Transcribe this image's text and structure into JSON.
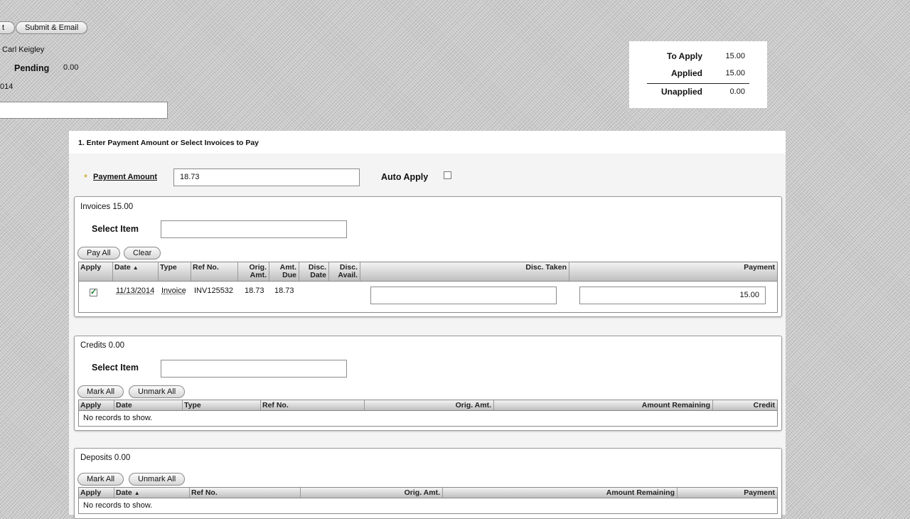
{
  "toolbar": {
    "partial_button_label": "t",
    "submit_email_label": "Submit & Email"
  },
  "header": {
    "customer_name": "Carl Keigley",
    "pending_label": "Pending",
    "pending_value": "0.00",
    "date_fragment": "014",
    "memo_value": ""
  },
  "summary": {
    "to_apply_label": "To Apply",
    "to_apply_value": "15.00",
    "applied_label": "Applied",
    "applied_value": "15.00",
    "unapplied_label": "Unapplied",
    "unapplied_value": "0.00"
  },
  "step": {
    "title": "1. Enter Payment Amount or Select Invoices to Pay",
    "required_mark": "*",
    "payment_amount_label": "Payment Amount",
    "payment_amount_value": "18.73",
    "auto_apply_label": "Auto Apply",
    "auto_apply_checked": false
  },
  "invoices": {
    "title": "Invoices 15.00",
    "select_item_label": "Select Item",
    "select_item_value": "",
    "pay_all_label": "Pay All",
    "clear_label": "Clear",
    "columns": [
      "Apply",
      "Date",
      "Type",
      "Ref No.",
      "Orig. Amt.",
      "Amt. Due",
      "Disc. Date",
      "Disc. Avail.",
      "Disc. Taken",
      "Payment"
    ],
    "rows": [
      {
        "apply": true,
        "date": "11/13/2014",
        "type": "Invoice",
        "ref_no": "INV125532",
        "orig_amt": "18.73",
        "amt_due": "18.73",
        "disc_date": "",
        "disc_avail": "",
        "disc_taken": "",
        "payment": "15.00"
      }
    ]
  },
  "credits": {
    "title": "Credits 0.00",
    "select_item_label": "Select Item",
    "select_item_value": "",
    "mark_all_label": "Mark All",
    "unmark_all_label": "Unmark All",
    "columns": [
      "Apply",
      "Date",
      "Type",
      "Ref No.",
      "Orig. Amt.",
      "Amount Remaining",
      "Credit"
    ],
    "empty_text": "No records to show."
  },
  "deposits": {
    "title": "Deposits 0.00",
    "mark_all_label": "Mark All",
    "unmark_all_label": "Unmark All",
    "columns": [
      "Apply",
      "Date",
      "Ref No.",
      "Orig. Amt.",
      "Amount Remaining",
      "Payment"
    ],
    "empty_text": "No records to show."
  }
}
